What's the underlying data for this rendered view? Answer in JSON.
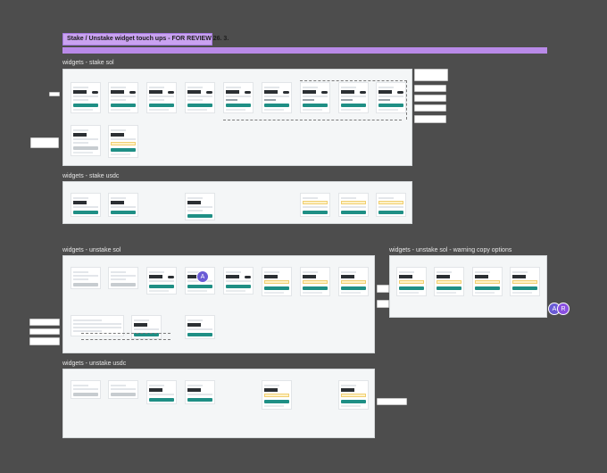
{
  "board_title": "Stake / Unstake widget touch ups - FOR REVIEW 26. 3.",
  "sections": [
    {
      "id": "stake-sol",
      "label": "widgets - stake sol"
    },
    {
      "id": "stake-usdc",
      "label": "widgets - stake usdc"
    },
    {
      "id": "unstake-sol",
      "label": "widgets - unstake sol"
    },
    {
      "id": "unstake-sol-warning",
      "label": "widgets - unstake sol - warning copy options"
    },
    {
      "id": "unstake-usdc",
      "label": "widgets - unstake usdc"
    }
  ],
  "avatars": [
    {
      "initial": "A",
      "color": "#6a5bd6"
    },
    {
      "initial": "A",
      "color": "#6a5bd6"
    },
    {
      "initial": "R",
      "color": "#8a4fe0"
    }
  ],
  "colors": {
    "canvas": "#4d4d4d",
    "title_fill": "#c9a2f0",
    "accent_bar": "#b98ae8",
    "primary_button": "#1f8f85",
    "warning": "#fff1c7"
  }
}
